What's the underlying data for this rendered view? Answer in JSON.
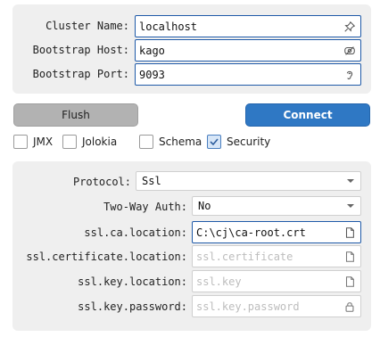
{
  "connection": {
    "cluster_name_label": "Cluster Name:",
    "cluster_name_value": "localhost",
    "bootstrap_host_label": "Bootstrap Host:",
    "bootstrap_host_value": "kago",
    "bootstrap_port_label": "Bootstrap Port:",
    "bootstrap_port_value": "9093"
  },
  "actions": {
    "flush_label": "Flush",
    "connect_label": "Connect"
  },
  "options": [
    {
      "label": "JMX",
      "checked": false
    },
    {
      "label": "Jolokia",
      "checked": false
    },
    {
      "label": "Schema",
      "checked": false
    },
    {
      "label": "Security",
      "checked": true
    }
  ],
  "security": {
    "protocol_label": "Protocol:",
    "protocol_value": "Ssl",
    "two_way_auth_label": "Two-Way Auth:",
    "two_way_auth_value": "No",
    "ca_location_label": "ssl.ca.location:",
    "ca_location_value": "C:\\cj\\ca-root.crt",
    "cert_location_label": "ssl.certificate.location:",
    "cert_location_placeholder": "ssl.certificate",
    "key_location_label": "ssl.key.location:",
    "key_location_placeholder": "ssl.key",
    "key_password_label": "ssl.key.password:",
    "key_password_placeholder": "ssl.key.password"
  },
  "colors": {
    "accent": "#2f78c4",
    "panel": "#efefef"
  }
}
